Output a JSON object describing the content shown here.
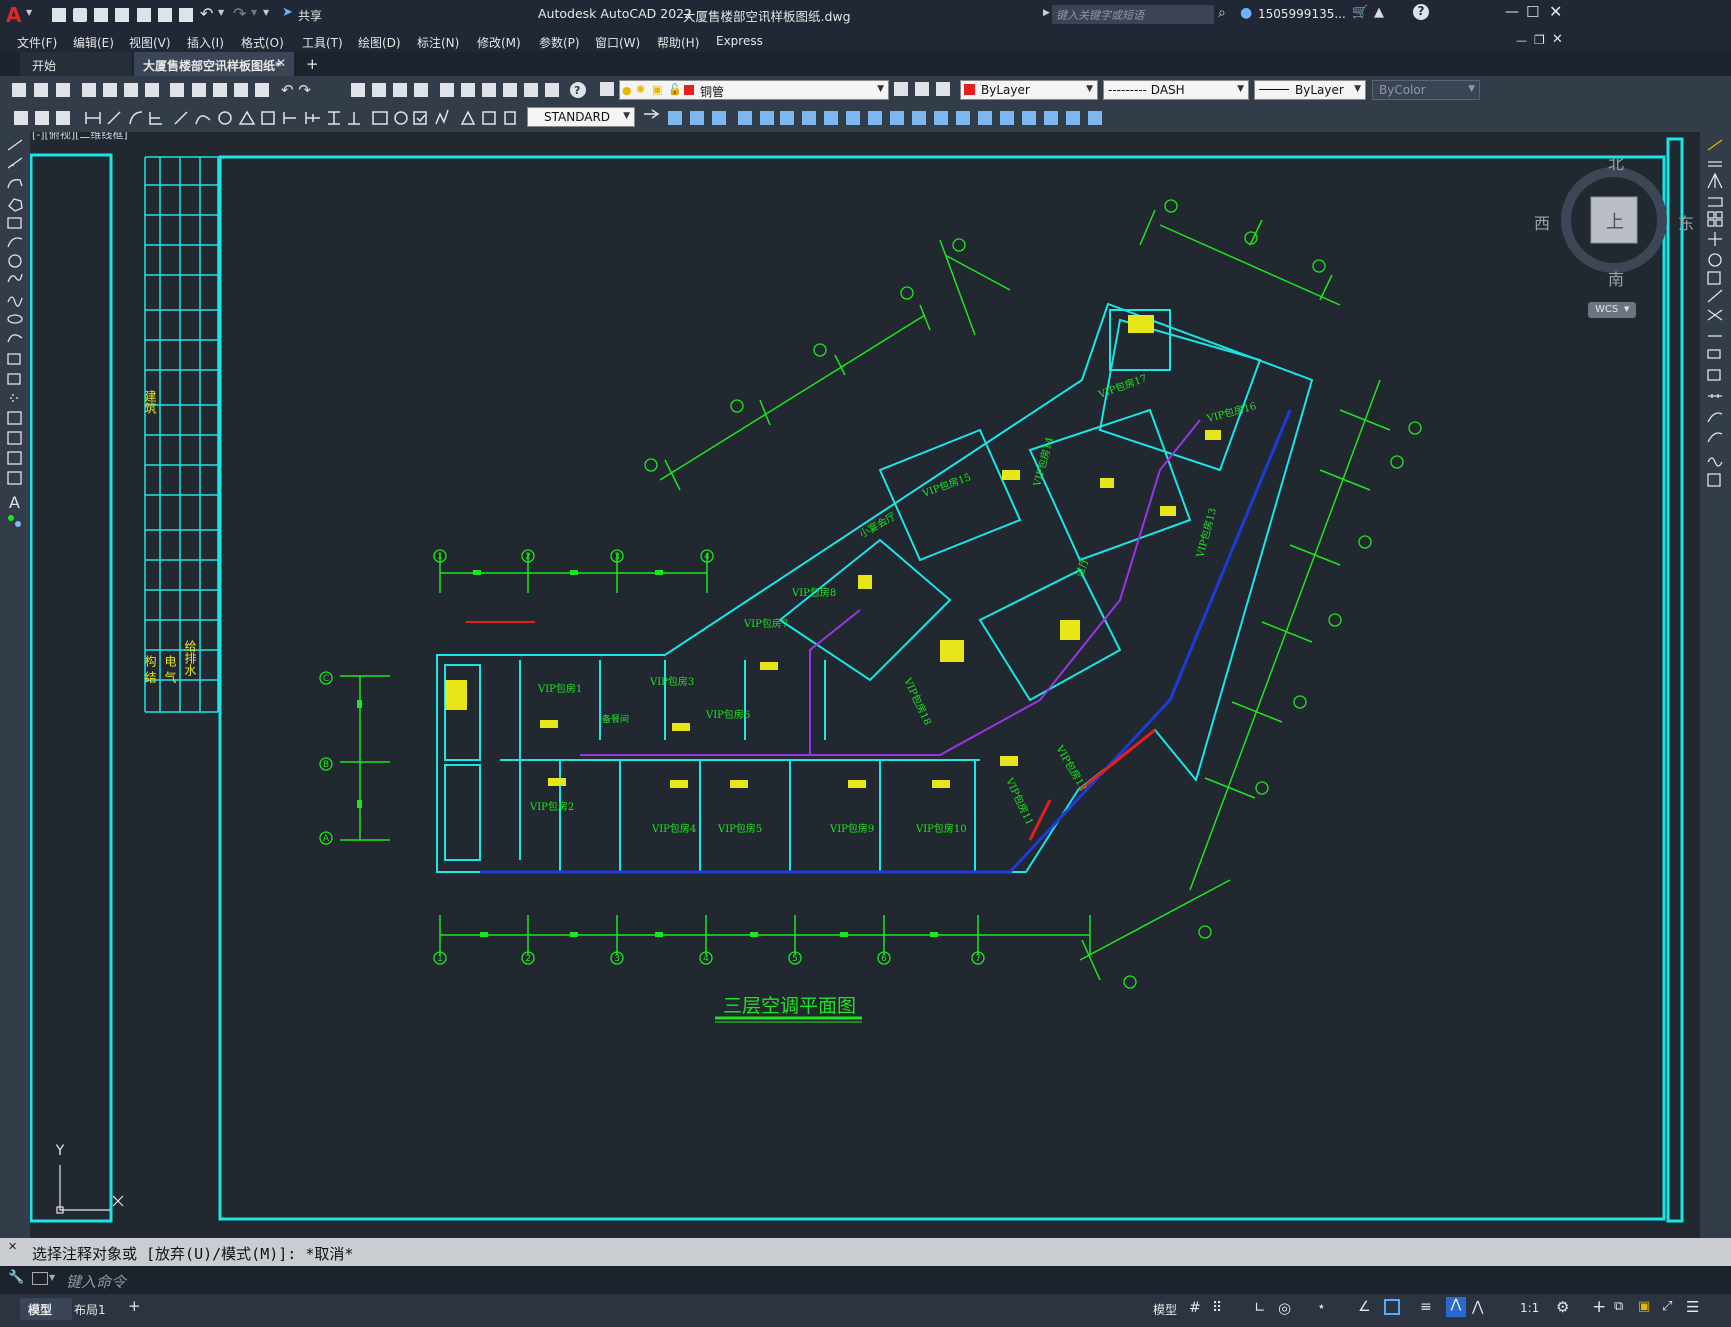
{
  "window": {
    "app_title": "Autodesk AutoCAD 2022",
    "doc_title": "大厦售楼部空讯样板图纸.dwg",
    "share_label": "共享",
    "search_placeholder": "键入关键字或短语",
    "user": "1505999135...",
    "logo": "A"
  },
  "menu": [
    "文件(F)",
    "编辑(E)",
    "视图(V)",
    "插入(I)",
    "格式(O)",
    "工具(T)",
    "绘图(D)",
    "标注(N)",
    "修改(M)",
    "参数(P)",
    "窗口(W)",
    "帮助(H)",
    "Express"
  ],
  "tabs": {
    "start": "开始",
    "active": "大厦售楼部空讯样板图纸*",
    "add": "+"
  },
  "properties": {
    "layer": "铜管",
    "color": "ByLayer",
    "linetype": "--------- DASH",
    "lineweight": "ByLayer",
    "plotstyle": "ByColor",
    "textstyle": "STANDARD"
  },
  "viewport": {
    "label": "[-][俯视][二维线框]",
    "drawing_title": "三层空调平面图",
    "ucs_y": "Y",
    "ucs_x": "X"
  },
  "viewcube": {
    "north": "北",
    "south": "南",
    "east": "东",
    "west": "西",
    "top": "上",
    "wcs": "WCS"
  },
  "rooms": [
    "VIP包房1",
    "VIP包房2",
    "VIP包房3",
    "VIP包房4",
    "VIP包房5",
    "VIP包房6",
    "VIP包房7",
    "VIP包房8",
    "VIP包房9",
    "VIP包房10",
    "VIP包房11",
    "VIP包房12",
    "VIP包房13",
    "VIP包房14",
    "VIP包房15",
    "VIP包房16",
    "VIP包房17",
    "VIP包房18",
    "小宴会厅",
    "过厅",
    "备餐间"
  ],
  "title_block": {
    "field1": "建筑",
    "field2": "构 结",
    "field3": "电 气",
    "field4": "给排水"
  },
  "axis_labels": {
    "top": [
      "1",
      "2",
      "3",
      "4"
    ],
    "bottom": [
      "1",
      "2",
      "3",
      "4",
      "5",
      "6",
      "7"
    ],
    "left": [
      "C",
      "B",
      "A"
    ]
  },
  "command": {
    "history": "选择注释对象或 [放弃(U)/模式(M)]: *取消*",
    "placeholder": "键入命令"
  },
  "status": {
    "layout_tabs": [
      "模型",
      "布局1"
    ],
    "add": "+",
    "model": "模型",
    "scale": "1:1"
  },
  "colors": {
    "background": "#212830",
    "border": "#19e6e6",
    "walls": "#19e6e6",
    "dims": "#1ee61e",
    "duct": "#1f3bd6",
    "pipe": "#9a35e6",
    "equip": "#e6e619",
    "red": "#e61e1e"
  }
}
